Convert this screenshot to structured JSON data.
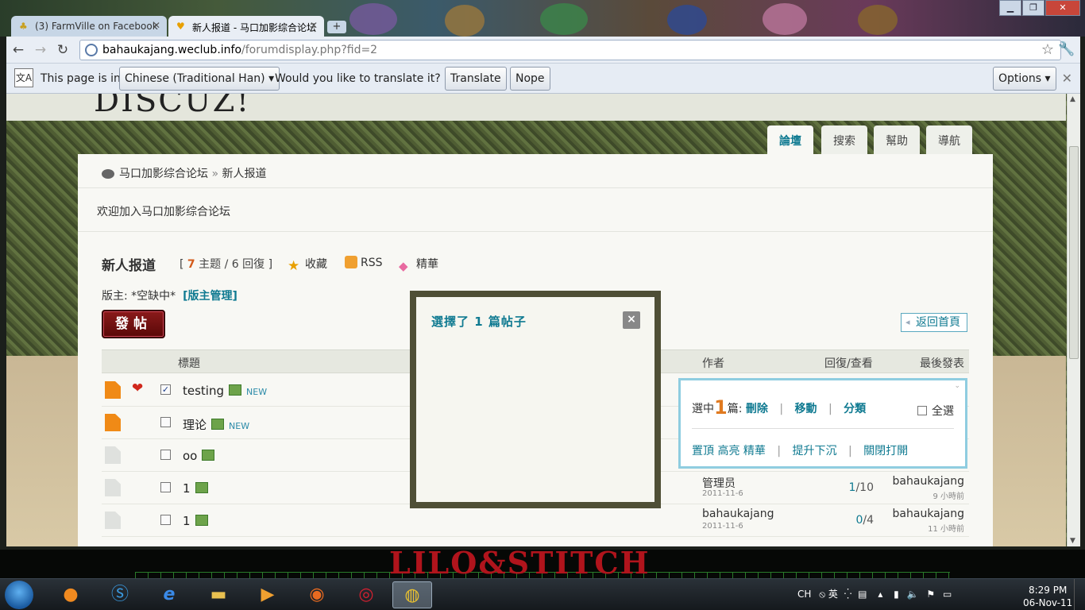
{
  "browser": {
    "tabs": [
      {
        "label": "(3) FarmVille on Facebook",
        "favicon": "farmville-icon",
        "active": false
      },
      {
        "label": "新人报道 - 马口加影综合论坛",
        "favicon": "weclub-icon",
        "active": true
      }
    ],
    "url_host": "bahaukajang.weclub.info",
    "url_path": "/forumdisplay.php?fid=2"
  },
  "translate_bar": {
    "intro": "This page is in",
    "language": "Chinese (Traditional Han)",
    "question": "Would you like to translate it?",
    "translate_label": "Translate",
    "nope_label": "Nope",
    "options_label": "Options"
  },
  "site": {
    "logo_text": "DISCUZ!",
    "nav_tabs": [
      "論壇",
      "搜索",
      "幫助",
      "導航"
    ],
    "breadcrumb_home": "马口加影综合论坛",
    "breadcrumb_sep": "»",
    "breadcrumb_current": "新人报道",
    "welcome": "欢迎加入马口加影综合论坛"
  },
  "forum": {
    "title": "新人报道",
    "open_bracket": "[",
    "topics_count": "7",
    "topics_label": "主题",
    "slash": "/",
    "replies_count": "6",
    "replies_label": "回復",
    "close_bracket": "]",
    "favorite_label": "收藏",
    "rss_label": "RSS",
    "digest_label": "精華",
    "moderator_prefix": "版主: *空缺中*",
    "moderator_manage": "[版主管理]",
    "post_button": "發帖",
    "back_home": "返回首頁"
  },
  "table": {
    "headers": {
      "title": "標題",
      "author": "作者",
      "replies_views": "回復/查看",
      "last_post": "最後發表"
    },
    "rows": [
      {
        "title": "testing",
        "is_new": "NEW",
        "checked": "✓",
        "icon": "hot",
        "heart": "❤"
      },
      {
        "title": "理论",
        "is_new": "NEW",
        "checked": "",
        "icon": "hot"
      },
      {
        "title": "oo",
        "checked": "",
        "icon": "plain"
      },
      {
        "title": "1",
        "checked": "",
        "icon": "plain",
        "author": "管理员",
        "date": "2011-11-6",
        "replies": "1",
        "views": "10",
        "last_by": "bahaukajang",
        "last_time": "9 小時前"
      },
      {
        "title": "1",
        "checked": "",
        "icon": "plain",
        "author": "bahaukajang",
        "date": "2011-11-6",
        "replies": "0",
        "views": "4",
        "last_by": "bahaukajang",
        "last_time": "11 小時前"
      }
    ]
  },
  "modbox": {
    "selected_prefix": "選中",
    "selected_count": "1",
    "selected_suffix": "篇:",
    "delete": "刪除",
    "move": "移動",
    "classify": "分類",
    "select_all": "全選",
    "sticky": "置頂",
    "highlight": "高亮",
    "digest": "精華",
    "bump": "提升下沉",
    "close_open": "關閉打開"
  },
  "dialog": {
    "title": "選擇了 1 篇帖子",
    "close": "×"
  },
  "taskbar": {
    "lang": "CH",
    "ime": "英",
    "time": "8:29 PM",
    "date": "06-Nov-11"
  },
  "colors": {
    "accent": "#0f7a91",
    "orange": "#e07a20",
    "dialog_border": "#4f4f36",
    "modbox_border": "#8fcde0"
  }
}
